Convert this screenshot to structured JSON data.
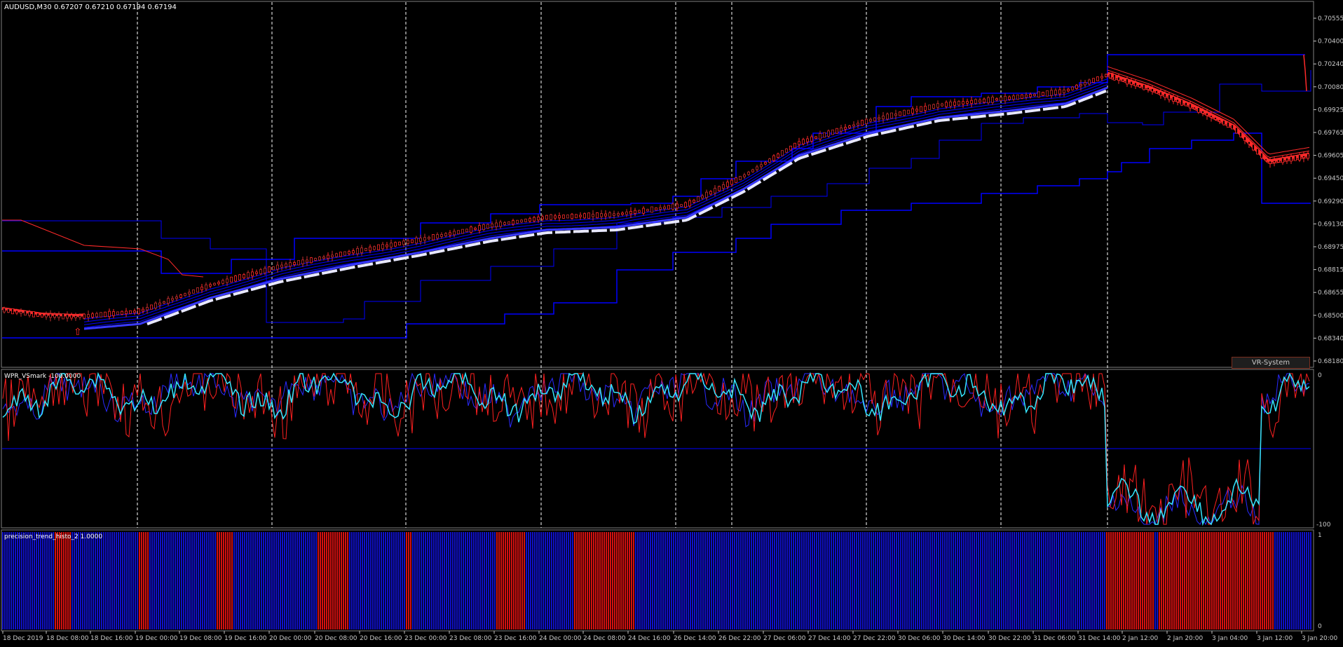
{
  "main_panel": {
    "symbol_label": "AUDUSD,M30  0.67207 0.67210 0.67194 0.67194",
    "price_ticks": [
      "0.70555",
      "0.70400",
      "0.70240",
      "0.70080",
      "0.69925",
      "0.69765",
      "0.69605",
      "0.69450",
      "0.69290",
      "0.69130",
      "0.68975",
      "0.68815",
      "0.68655",
      "0.68500",
      "0.68340",
      "0.68180"
    ],
    "button_label": "VR-System"
  },
  "wpr_panel": {
    "label": "WPR_VSmark -100.0000",
    "scale_top": "0",
    "scale_bottom": "-100"
  },
  "histo_panel": {
    "label": "precision_trend_histo_2 1.0000",
    "scale_top": "1",
    "scale_bottom": "0"
  },
  "time_axis": [
    "18 Dec 2019",
    "18 Dec 08:00",
    "18 Dec 16:00",
    "19 Dec 00:00",
    "19 Dec 08:00",
    "19 Dec 16:00",
    "20 Dec 00:00",
    "20 Dec 08:00",
    "20 Dec 16:00",
    "23 Dec 00:00",
    "23 Dec 08:00",
    "23 Dec 16:00",
    "24 Dec 00:00",
    "24 Dec 08:00",
    "24 Dec 16:00",
    "26 Dec 14:00",
    "26 Dec 22:00",
    "27 Dec 06:00",
    "27 Dec 14:00",
    "27 Dec 22:00",
    "30 Dec 06:00",
    "30 Dec 14:00",
    "30 Dec 22:00",
    "31 Dec 06:00",
    "31 Dec 14:00",
    "2 Jan 12:00",
    "2 Jan 20:00",
    "3 Jan 04:00",
    "3 Jan 12:00",
    "3 Jan 20:00"
  ],
  "colors": {
    "background": "#000000",
    "grid": "#ffffff",
    "channel": "#0000ff",
    "ma_fast": "#3a3aff",
    "ma_white": "#e8e8ff",
    "down_trend": "#ff2a2a",
    "wpr_main": "#35e6ff",
    "wpr_signal": "#ff2020",
    "wpr_slow": "#2a2aff",
    "histo_up": "#1010c8",
    "histo_down": "#d41010",
    "text": "#ffffff",
    "axis_text": "#c8c8c8"
  }
}
